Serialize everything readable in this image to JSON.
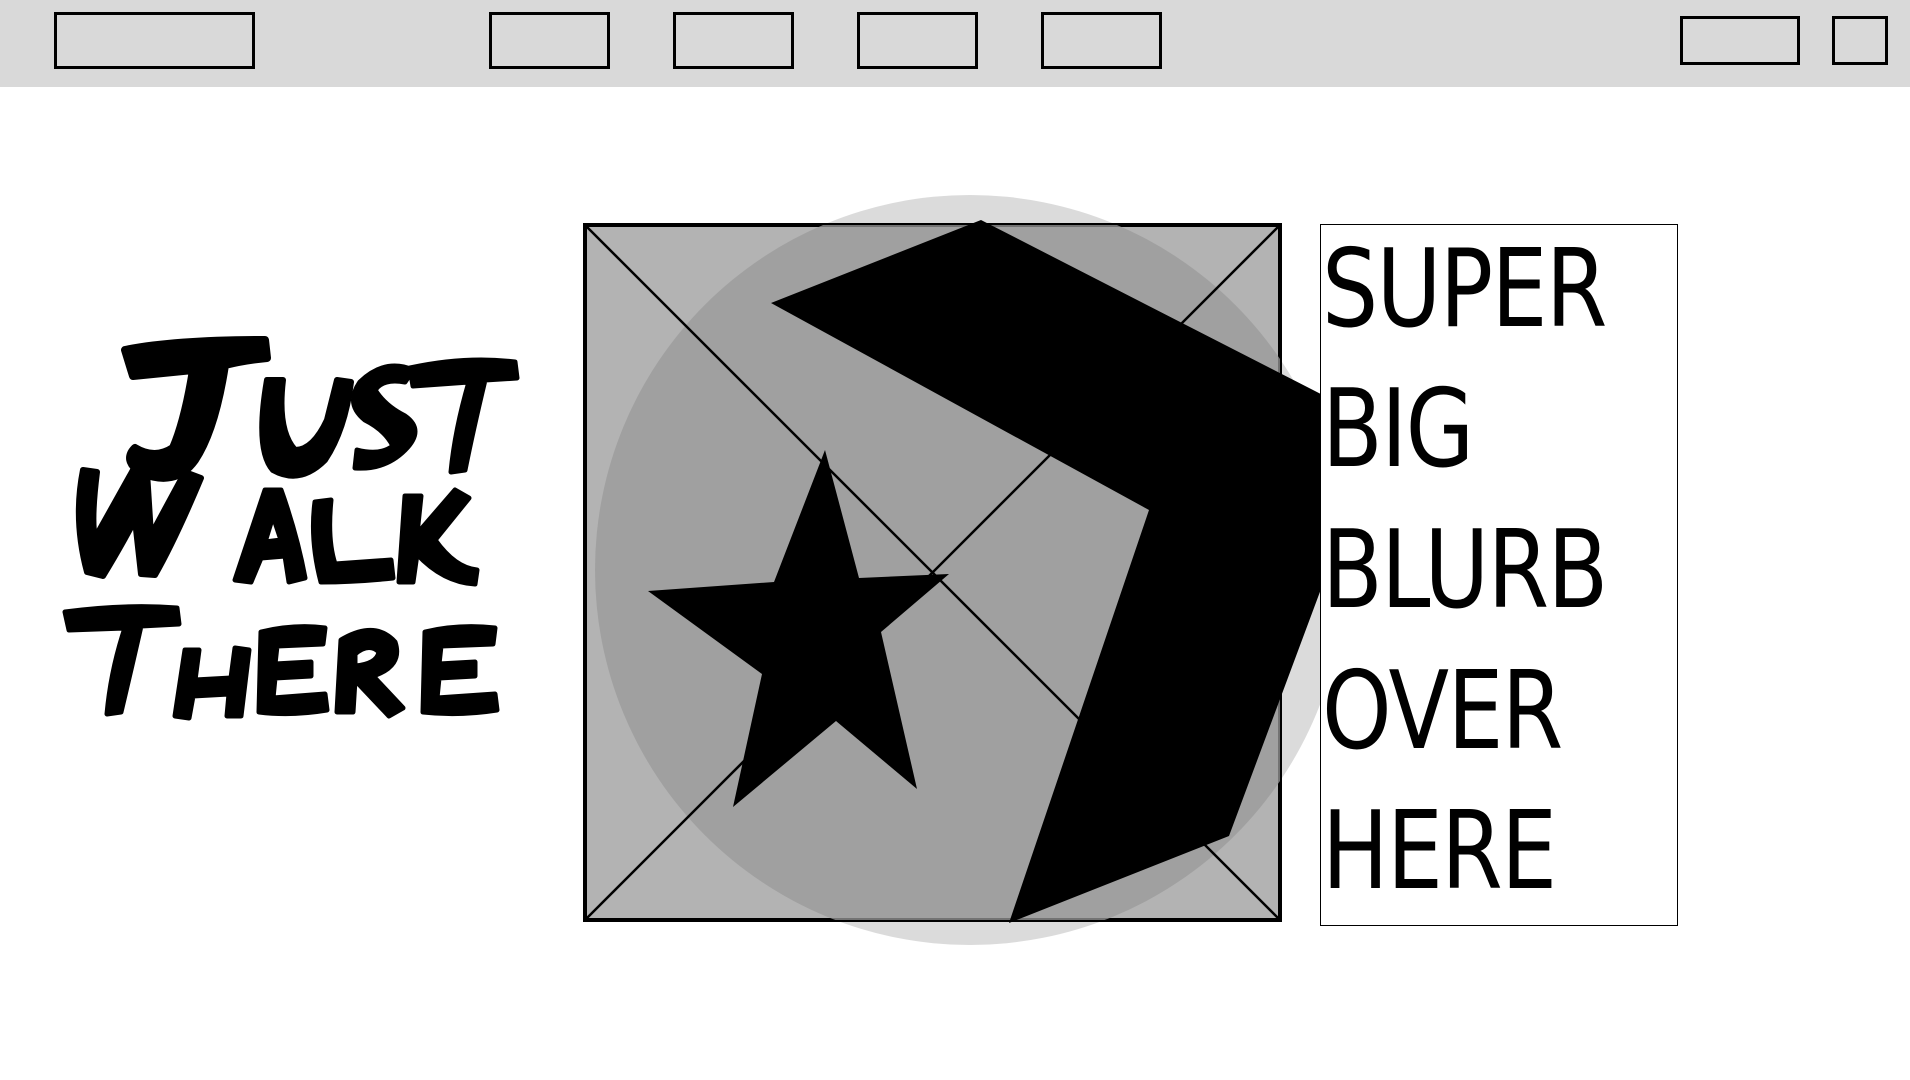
{
  "nav": {
    "logo": "",
    "links": [
      "",
      "",
      "",
      ""
    ],
    "actions": [
      "",
      ""
    ]
  },
  "hero": {
    "headline_words": [
      "JUST",
      "WALK",
      "THERE"
    ],
    "blurb_lines": [
      "SUPER",
      "BIG",
      "BLURB",
      "OVER",
      "HERE"
    ]
  },
  "icons": {
    "star": "star-icon",
    "placeholder": "image-placeholder-icon",
    "arrow": "chevron-shape-icon"
  },
  "colors": {
    "topbar": "#d9d9d9",
    "placeholder_fill": "#b3b3b3",
    "circle_fill": "#999999",
    "ink": "#000000"
  }
}
